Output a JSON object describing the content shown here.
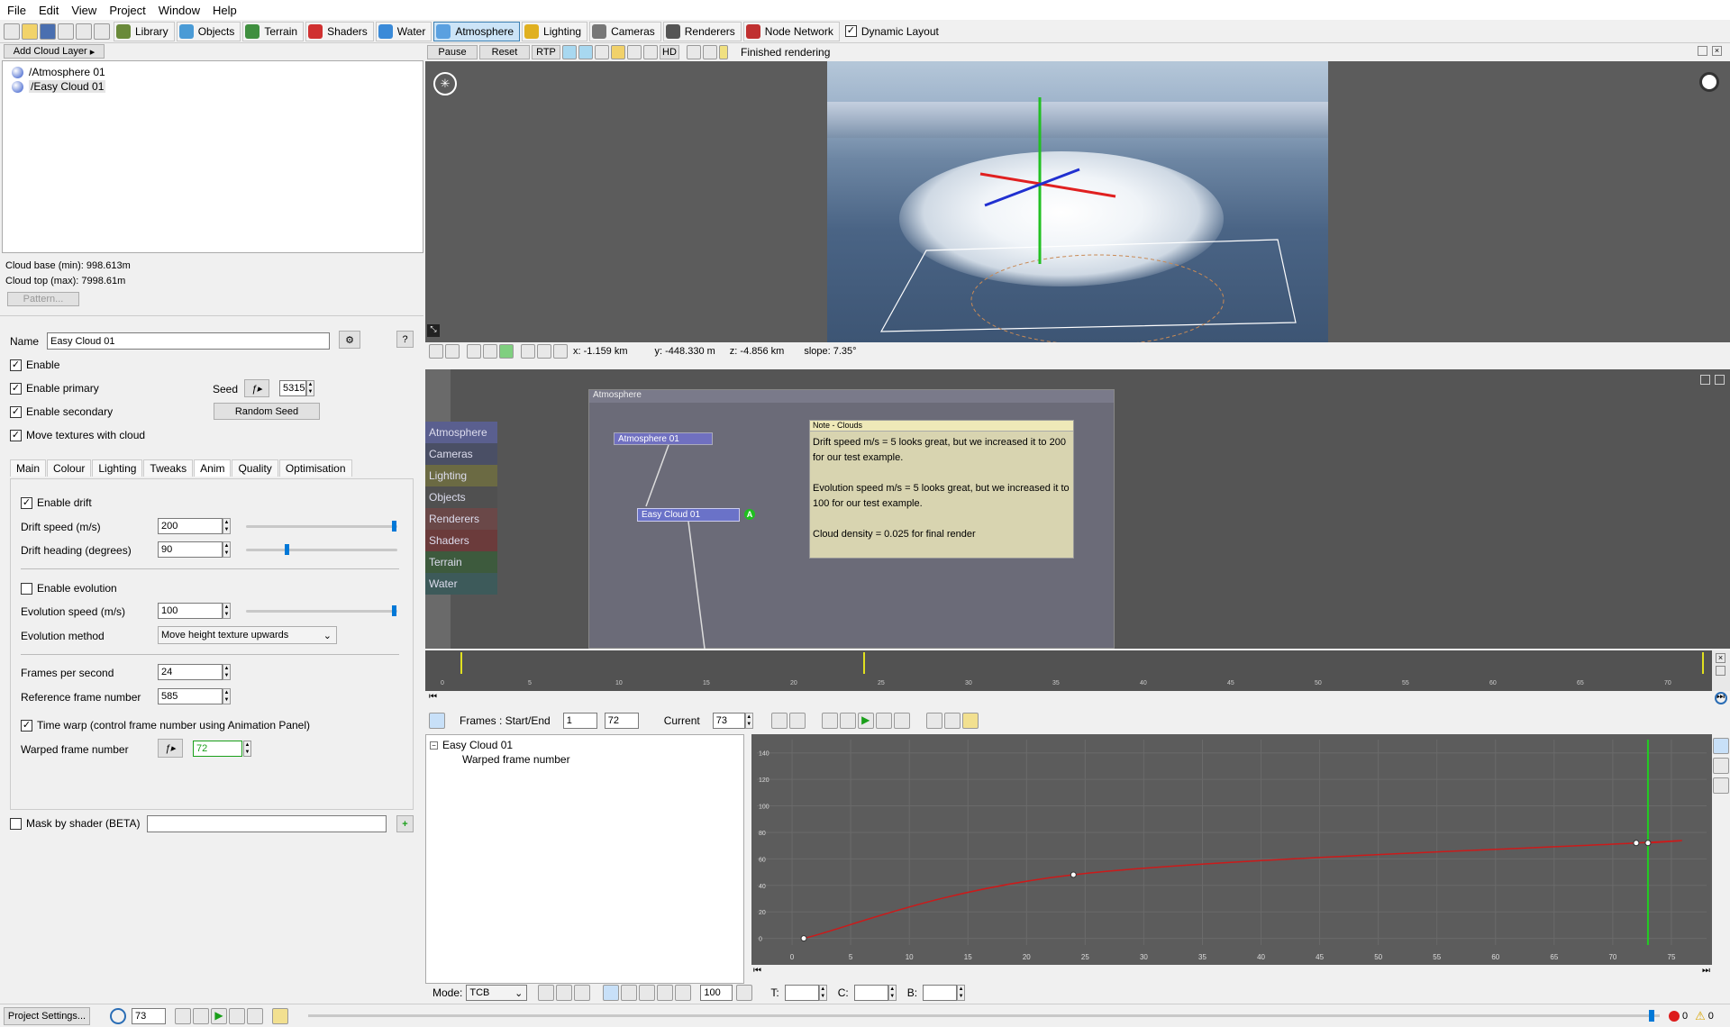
{
  "menu": [
    "File",
    "Edit",
    "View",
    "Project",
    "Window",
    "Help"
  ],
  "toolbar": {
    "items": [
      {
        "label": "Library",
        "icon": "library-icon",
        "color": "#6a8a3a"
      },
      {
        "label": "Objects",
        "icon": "objects-icon",
        "color": "#4a9bd6"
      },
      {
        "label": "Terrain",
        "icon": "terrain-icon",
        "color": "#3f8f3f"
      },
      {
        "label": "Shaders",
        "icon": "shaders-icon",
        "color": "#d03030"
      },
      {
        "label": "Water",
        "icon": "water-icon",
        "color": "#3a8ad8"
      },
      {
        "label": "Atmosphere",
        "icon": "atmosphere-icon",
        "color": "#5aa0e0",
        "active": true
      },
      {
        "label": "Lighting",
        "icon": "lighting-icon",
        "color": "#e0b020"
      },
      {
        "label": "Cameras",
        "icon": "cameras-icon",
        "color": "#777777"
      },
      {
        "label": "Renderers",
        "icon": "renderers-icon",
        "color": "#555555"
      },
      {
        "label": "Node Network",
        "icon": "node-network-icon",
        "color": "#c03030"
      }
    ],
    "dynamic_layout": "Dynamic Layout"
  },
  "left": {
    "add_cloud_layer": "Add Cloud Layer",
    "tree": [
      "/Atmosphere 01",
      "/Easy Cloud 01"
    ],
    "cloud_base": "Cloud base (min): 998.613m",
    "cloud_top": "Cloud top (max): 7998.61m",
    "pattern_btn": "Pattern...",
    "name_label": "Name",
    "name_value": "Easy Cloud 01",
    "help": "?",
    "enable": "Enable",
    "enable_primary": "Enable primary",
    "enable_secondary": "Enable secondary",
    "move_textures": "Move textures with cloud",
    "seed_label": "Seed",
    "seed_value": "5315",
    "random_seed": "Random Seed",
    "tabs": [
      "Main",
      "Colour",
      "Lighting",
      "Tweaks",
      "Anim",
      "Quality",
      "Optimisation"
    ],
    "enable_drift": "Enable drift",
    "drift_speed_label": "Drift speed (m/s)",
    "drift_speed": "200",
    "drift_heading_label": "Drift heading (degrees)",
    "drift_heading": "90",
    "enable_evolution": "Enable evolution",
    "evolution_speed_label": "Evolution speed (m/s)",
    "evolution_speed": "100",
    "evolution_method_label": "Evolution method",
    "evolution_method": "Move height texture upwards",
    "fps_label": "Frames per second",
    "fps": "24",
    "ref_frame_label": "Reference frame number",
    "ref_frame": "585",
    "time_warp": "Time warp (control frame number using Animation Panel)",
    "warped_label": "Warped frame number",
    "warped_value": "72",
    "mask": "Mask by shader (BETA)"
  },
  "render": {
    "pause": "Pause",
    "reset": "Reset",
    "rtp": "RTP",
    "hd": "HD",
    "status": "Finished rendering",
    "coords": {
      "x": "x: -1.159 km",
      "y": "y: -448.330 m",
      "z": "z: -4.856 km",
      "slope": "slope: 7.35°"
    }
  },
  "network": {
    "title": "Atmosphere",
    "categories": [
      {
        "label": "Atmosphere",
        "color": "#5a5f8f"
      },
      {
        "label": "Cameras",
        "color": "#4a4f65"
      },
      {
        "label": "Lighting",
        "color": "#6b6a43"
      },
      {
        "label": "Objects",
        "color": "#505050"
      },
      {
        "label": "Renderers",
        "color": "#6a4848"
      },
      {
        "label": "Shaders",
        "color": "#6b3b3b"
      },
      {
        "label": "Terrain",
        "color": "#3d5a3d"
      },
      {
        "label": "Water",
        "color": "#3d5a5a"
      }
    ],
    "nodes": [
      "Atmosphere 01",
      "Easy Cloud 01"
    ],
    "badge": "A",
    "note_title": "Note - Clouds",
    "note_lines": [
      "Drift speed m/s = 5 looks great, but we increased it to 200 for our test example.",
      "Evolution speed m/s = 5 looks great, but we increased it to 100 for our test example.",
      "Cloud density = 0.025 for final render"
    ]
  },
  "timeline": {
    "ticks": [
      "0",
      "5",
      "10",
      "15",
      "20",
      "25",
      "30",
      "35",
      "40",
      "45",
      "50",
      "55",
      "60",
      "65",
      "70"
    ],
    "keyframes": [
      1,
      24,
      72,
      73
    ]
  },
  "anim": {
    "frames_label": "Frames : Start/End",
    "start": "1",
    "end": "72",
    "current_label": "Current",
    "current": "73",
    "tree_root": "Easy Cloud 01",
    "tree_child": "Warped frame number",
    "mode_label": "Mode:",
    "mode": "TCB",
    "zoom": "100",
    "t_label": "T:",
    "c_label": "C:",
    "b_label": "B:"
  },
  "chart_data": {
    "type": "line",
    "series": [
      {
        "x": [
          1,
          24,
          72,
          73
        ],
        "y": [
          0,
          48,
          72,
          72
        ]
      }
    ],
    "xlim": [
      -3,
      78
    ],
    "ylim": [
      -5,
      150
    ],
    "x_ticks": [
      0,
      5,
      10,
      15,
      20,
      25,
      30,
      35,
      40,
      45,
      50,
      55,
      60,
      65,
      70,
      75
    ],
    "y_ticks": [
      0,
      20,
      40,
      60,
      80,
      100,
      120,
      140
    ],
    "current_frame": 73,
    "line_color": "#cc1a1a",
    "cursor_color": "#22cc22"
  },
  "bottom": {
    "project_settings": "Project Settings...",
    "frame": "73",
    "errors": "0",
    "warnings": "0"
  }
}
